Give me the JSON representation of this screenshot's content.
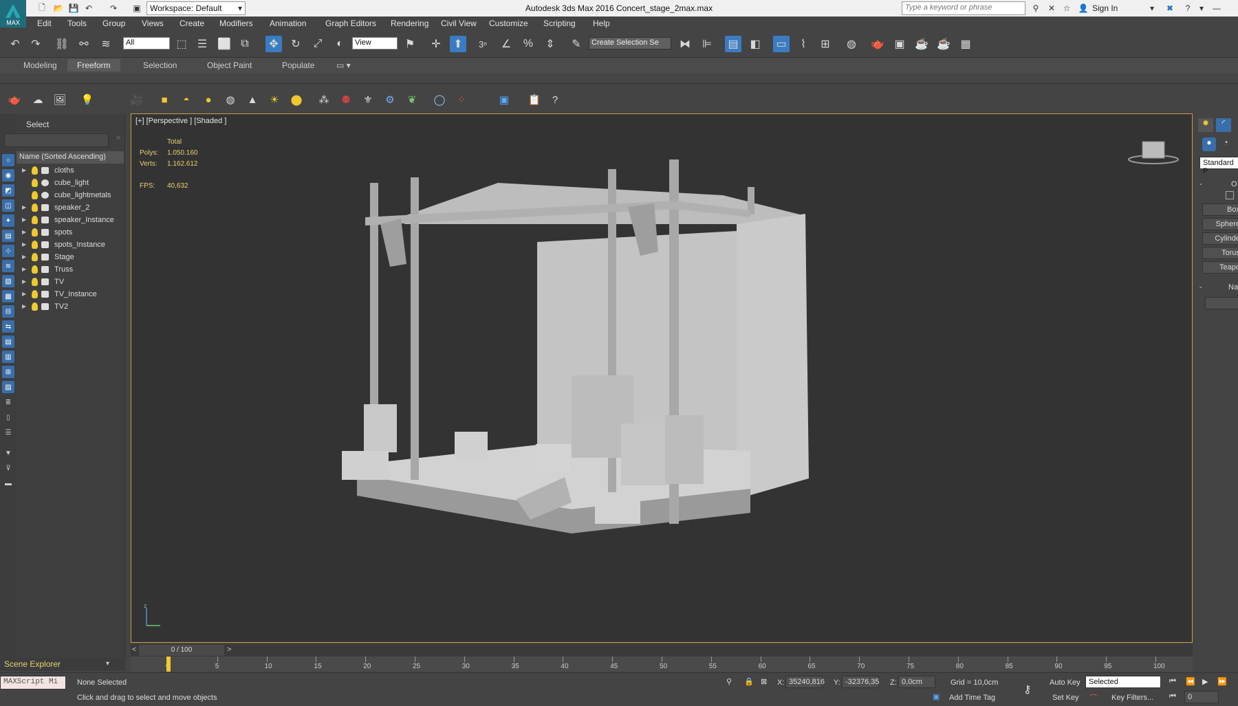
{
  "window": {
    "title": "Autodesk 3ds Max 2016     Concert_stage_2max.max",
    "logo_text": "MAX",
    "workspace": "Workspace: Default",
    "search_placeholder": "Type a keyword or phrase",
    "sign_in": "Sign In"
  },
  "menu": [
    "Edit",
    "Tools",
    "Group",
    "Views",
    "Create",
    "Modifiers",
    "Animation",
    "Graph Editors",
    "Rendering",
    "Civil View",
    "Customize",
    "Scripting",
    "Help"
  ],
  "toolbar": {
    "filter": "All",
    "ref_coord": "View",
    "selection_set": "Create Selection Se",
    "snap_label": "3"
  },
  "ribbon_tabs": [
    "Modeling",
    "Freeform",
    "Selection",
    "Object Paint",
    "Populate"
  ],
  "ribbon_active": "Freeform",
  "explorer": {
    "header": "Select",
    "column": "Name (Sorted Ascending)",
    "items": [
      {
        "name": "cloths",
        "expand": true,
        "round": false
      },
      {
        "name": "cube_light",
        "expand": false,
        "round": true
      },
      {
        "name": "cube_lightmetals",
        "expand": false,
        "round": true
      },
      {
        "name": "speaker_2",
        "expand": true,
        "round": false
      },
      {
        "name": "speaker_Instance",
        "expand": true,
        "round": false
      },
      {
        "name": "spots",
        "expand": true,
        "round": false
      },
      {
        "name": "spots_Instance",
        "expand": true,
        "round": false
      },
      {
        "name": "Stage",
        "expand": true,
        "round": false
      },
      {
        "name": "Truss",
        "expand": true,
        "round": false
      },
      {
        "name": "TV",
        "expand": true,
        "round": false
      },
      {
        "name": "TV_Instance",
        "expand": true,
        "round": false
      },
      {
        "name": "TV2",
        "expand": true,
        "round": false
      }
    ],
    "footer": "Scene Explorer"
  },
  "viewport": {
    "label": "[+] [Perspective ] [Shaded ]",
    "stats_total": "Total",
    "polys_label": "Polys:",
    "polys_value": "1.050.160",
    "verts_label": "Verts:",
    "verts_value": "1.162.612",
    "fps_label": "FPS:",
    "fps_value": "40,632",
    "axis_z": "z"
  },
  "command_panel": {
    "dropdown": "Standard P",
    "rollout1": "O",
    "buttons": [
      "Box",
      "Sphere",
      "Cylinde",
      "Torus",
      "Teapo"
    ],
    "rollout2": "Na"
  },
  "timeline": {
    "frame": "0 / 100",
    "ticks": [
      "0",
      "5",
      "10",
      "15",
      "20",
      "25",
      "30",
      "35",
      "40",
      "45",
      "50",
      "55",
      "60",
      "65",
      "70",
      "75",
      "80",
      "85",
      "90",
      "95",
      "100"
    ]
  },
  "status": {
    "maxscript": "MAXScript Mi",
    "selection": "None Selected",
    "prompt": "Click and drag to select and move objects",
    "x_label": "X:",
    "x_value": "35240,816",
    "y_label": "Y:",
    "y_value": "-32376,35",
    "z_label": "Z:",
    "z_value": "0,0cm",
    "grid": "Grid = 10,0cm",
    "add_time_tag": "Add Time Tag",
    "auto_key": "Auto Key",
    "key_mode": "Selected",
    "set_key": "Set Key",
    "key_filters": "Key Filters...",
    "frame_field": "0"
  }
}
